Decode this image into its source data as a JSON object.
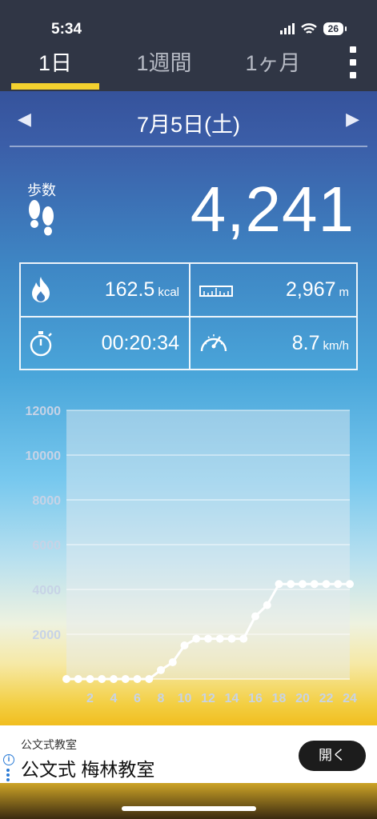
{
  "status_bar": {
    "time": "5:34",
    "battery": "26"
  },
  "tabs": [
    {
      "label": "1日",
      "active": true
    },
    {
      "label": "1週間",
      "active": false
    },
    {
      "label": "1ヶ月",
      "active": false
    }
  ],
  "date_nav": {
    "prev": "◀",
    "date": "7月5日(土)",
    "next": "▶"
  },
  "steps": {
    "label": "歩数",
    "value": "4,241"
  },
  "stats": {
    "calories": {
      "value": "162.5",
      "unit": "kcal"
    },
    "distance": {
      "value": "2,967",
      "unit": "m"
    },
    "time": {
      "value": "00:20:34"
    },
    "speed": {
      "value": "8.7",
      "unit": "km/h"
    }
  },
  "chart_data": {
    "type": "line",
    "title": "",
    "xlabel": "",
    "ylabel": "",
    "x": [
      0,
      1,
      2,
      3,
      4,
      5,
      6,
      7,
      8,
      9,
      10,
      11,
      12,
      13,
      14,
      15,
      16,
      17,
      18,
      19,
      20,
      21,
      22,
      23,
      24
    ],
    "values": [
      0,
      0,
      0,
      0,
      0,
      0,
      0,
      0,
      400,
      750,
      1500,
      1800,
      1800,
      1800,
      1800,
      1800,
      2800,
      3300,
      4241,
      4241,
      4241,
      4241,
      4241,
      4241,
      4241
    ],
    "xlim": [
      0,
      24
    ],
    "ylim": [
      0,
      12000
    ],
    "x_ticks": [
      "2",
      "4",
      "6",
      "8",
      "10",
      "12",
      "14",
      "16",
      "18",
      "20",
      "22",
      "24"
    ],
    "y_ticks": [
      "2000",
      "4000",
      "6000",
      "8000",
      "10000",
      "12000"
    ],
    "grid": true,
    "colors": {
      "line": "#ffffff",
      "tick_label": "#c7d3e6",
      "plot_bg": "rgba(230,236,240,0.45)"
    }
  },
  "ad": {
    "subtitle": "公文式教室",
    "title": "公文式 梅林教室",
    "button": "開く"
  }
}
